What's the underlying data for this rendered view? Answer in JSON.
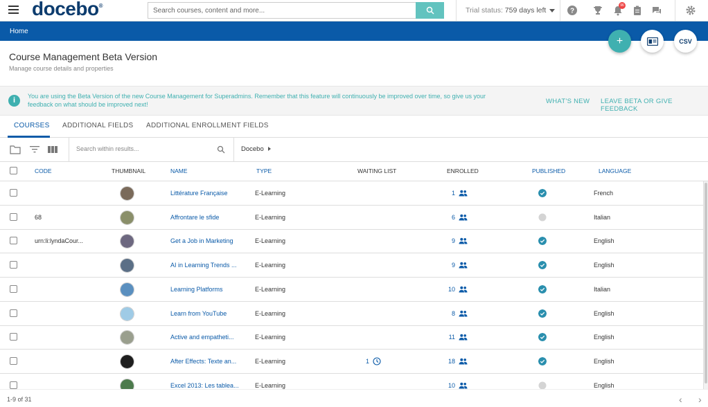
{
  "topbar": {
    "logo": "docebo",
    "logo_mark": "®",
    "search_placeholder": "Search courses, content and more...",
    "trial_label": "Trial status:",
    "trial_value": "759 days left",
    "notification_count": "96",
    "icons": [
      "menu-icon",
      "search-icon",
      "help-icon",
      "trophy-icon",
      "bell-icon",
      "clipboard-icon",
      "chat-icon",
      "gear-icon"
    ]
  },
  "breadcrumb": {
    "home": "Home"
  },
  "fabs": {
    "add": "+",
    "csv": "CSV"
  },
  "page": {
    "title": "Course Management Beta Version",
    "subtitle": "Manage course details and properties"
  },
  "banner": {
    "info": "i",
    "text": "You are using the Beta Version of the new Course Management for Superadmins. Remember that this feature will continuously be improved over time, so give us your feedback on what should be improved next!",
    "whats_new": "WHAT'S NEW",
    "leave_beta": "LEAVE BETA OR GIVE FEEDBACK"
  },
  "tabs": [
    "COURSES",
    "ADDITIONAL FIELDS",
    "ADDITIONAL ENROLLMENT FIELDS"
  ],
  "toolbar": {
    "search_placeholder": "Search within results...",
    "folder": "Docebo"
  },
  "table": {
    "headers": {
      "code": "CODE",
      "thumbnail": "THUMBNAIL",
      "name": "NAME",
      "type": "TYPE",
      "waiting_list": "WAITING LIST",
      "enrolled": "ENROLLED",
      "published": "PUBLISHED",
      "language": "LANGUAGE"
    },
    "rows": [
      {
        "code": "",
        "name": "Littérature Française",
        "type": "E-Learning",
        "waiting": "",
        "enrolled": "1",
        "published": true,
        "language": "French",
        "thumb_color": "#7a6a5a"
      },
      {
        "code": "68",
        "name": "Affrontare le sfide",
        "type": "E-Learning",
        "waiting": "",
        "enrolled": "6",
        "published": false,
        "language": "Italian",
        "thumb_color": "#8a8f6a"
      },
      {
        "code": "urn:li:lyndaCour...",
        "name": "Get a Job in Marketing",
        "type": "E-Learning",
        "waiting": "",
        "enrolled": "9",
        "published": true,
        "language": "English",
        "thumb_color": "#6d6880"
      },
      {
        "code": "",
        "name": "AI in Learning Trends ...",
        "type": "E-Learning",
        "waiting": "",
        "enrolled": "9",
        "published": true,
        "language": "English",
        "thumb_color": "#5b6f86"
      },
      {
        "code": "",
        "name": "Learning Platforms",
        "type": "E-Learning",
        "waiting": "",
        "enrolled": "10",
        "published": true,
        "language": "Italian",
        "thumb_color": "#5a8fbf"
      },
      {
        "code": "",
        "name": "Learn from YouTube",
        "type": "E-Learning",
        "waiting": "",
        "enrolled": "8",
        "published": true,
        "language": "English",
        "thumb_color": "#9fcbe6"
      },
      {
        "code": "",
        "name": "Active and empatheti...",
        "type": "E-Learning",
        "waiting": "",
        "enrolled": "11",
        "published": true,
        "language": "English",
        "thumb_color": "#9a9f8e"
      },
      {
        "code": "",
        "name": "After Effects: Texte an...",
        "type": "E-Learning",
        "waiting": "1",
        "enrolled": "18",
        "published": true,
        "language": "English",
        "thumb_color": "#1e1e1e"
      },
      {
        "code": "",
        "name": "Excel 2013: Les tablea...",
        "type": "E-Learning",
        "waiting": "",
        "enrolled": "10",
        "published": false,
        "language": "English",
        "thumb_color": "#4c7a4c"
      }
    ]
  },
  "pager": {
    "text": "1-9 of 31",
    "prev": "‹",
    "next": "›"
  },
  "colors": {
    "brand_blue": "#0a5aa8",
    "teal": "#3fb0b0",
    "logo_navy": "#0d3c6e"
  }
}
